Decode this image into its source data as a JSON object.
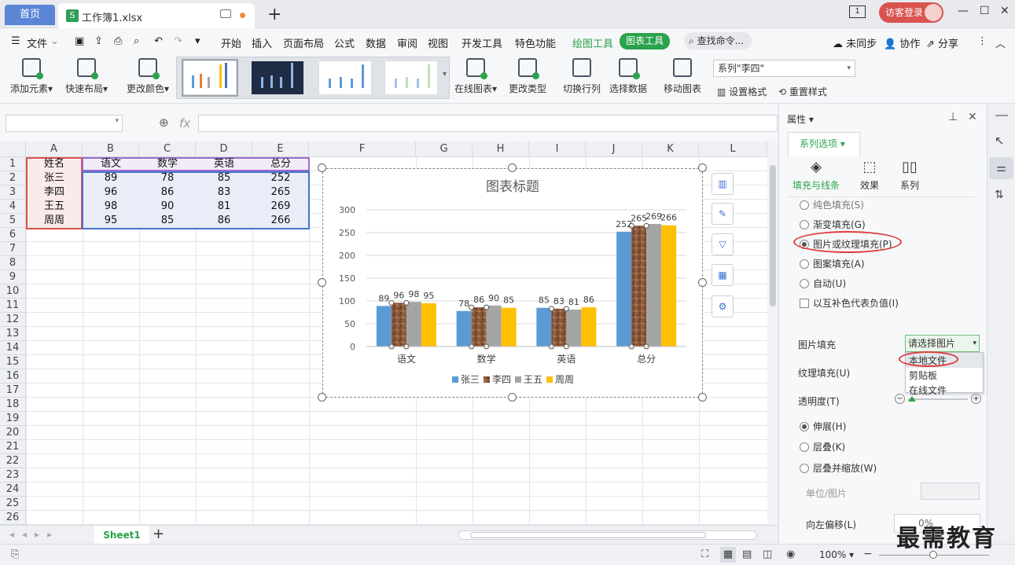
{
  "titlebar": {
    "home_tab": "首页",
    "doc_tab": "工作簿1.xlsx",
    "doc_logo": "S",
    "page_indicator": "1",
    "login": "访客登录"
  },
  "menubar": {
    "file": "文件",
    "items": [
      "开始",
      "插入",
      "页面布局",
      "公式",
      "数据",
      "审阅",
      "视图",
      "开发工具",
      "特色功能"
    ],
    "draw_tools": "绘图工具",
    "chart_tools": "图表工具",
    "search": "查找命令...",
    "sync": "未同步",
    "collab": "协作",
    "share": "分享"
  },
  "ribbon": {
    "add_element": "添加元素",
    "quick_layout": "快速布局",
    "change_color": "更改颜色",
    "online_chart": "在线图表",
    "change_type": "更改类型",
    "switch_rowcol": "切换行列",
    "select_data": "选择数据",
    "move_chart": "移动图表",
    "series_select": "系列\"李四\"",
    "set_format": "设置格式",
    "reset_style": "重置样式"
  },
  "sheet": {
    "columns": [
      "A",
      "B",
      "C",
      "D",
      "E",
      "F",
      "G",
      "H",
      "I",
      "J",
      "K",
      "L"
    ],
    "rows": [
      "1",
      "2",
      "3",
      "4",
      "5",
      "6",
      "7",
      "8",
      "9",
      "10",
      "11",
      "12",
      "13",
      "14",
      "15",
      "16",
      "17",
      "18",
      "19",
      "20",
      "21",
      "22",
      "23",
      "24",
      "25",
      "26"
    ],
    "table": [
      [
        "姓名",
        "语文",
        "数学",
        "英语",
        "总分"
      ],
      [
        "张三",
        "89",
        "78",
        "85",
        "252"
      ],
      [
        "李四",
        "96",
        "86",
        "83",
        "265"
      ],
      [
        "王五",
        "98",
        "90",
        "81",
        "269"
      ],
      [
        "周周",
        "95",
        "85",
        "86",
        "266"
      ]
    ],
    "tab_name": "Sheet1"
  },
  "chart_data": {
    "type": "bar",
    "title": "图表标题",
    "categories": [
      "语文",
      "数学",
      "英语",
      "总分"
    ],
    "series": [
      {
        "name": "张三",
        "values": [
          89,
          78,
          85,
          252
        ],
        "color": "#5b9bd5"
      },
      {
        "name": "李四",
        "values": [
          96,
          86,
          83,
          265
        ],
        "color": "#8b5a3c"
      },
      {
        "name": "王五",
        "values": [
          98,
          90,
          81,
          269
        ],
        "color": "#a5a5a5"
      },
      {
        "name": "周周",
        "values": [
          95,
          85,
          86,
          266
        ],
        "color": "#ffc000"
      }
    ],
    "yticks": [
      0,
      50,
      100,
      150,
      200,
      250,
      300
    ],
    "ylim": [
      0,
      300
    ],
    "legend": "bottom",
    "grid": true
  },
  "panel": {
    "title": "属性",
    "series_options": "系列选项",
    "tabs": [
      "填充与线条",
      "效果",
      "系列"
    ],
    "options": [
      "纯色填充(S)",
      "渐变填充(G)",
      "图片或纹理填充(P)",
      "图案填充(A)",
      "自动(U)"
    ],
    "invert": "以互补色代表负值(I)",
    "picture_fill": "图片填充",
    "picture_select": "请选择图片",
    "dropdown": [
      "本地文件",
      "剪贴板",
      "在线文件"
    ],
    "texture_fill": "纹理填充(U)",
    "transparency": "透明度(T)",
    "stretch_opts": [
      "伸展(H)",
      "层叠(K)",
      "层叠并缩放(W)"
    ],
    "unit": "单位/图片",
    "offset_left": "向左偏移(L)",
    "offset_value": "0%"
  },
  "status": {
    "zoom": "100%"
  },
  "watermark": "最需教育"
}
